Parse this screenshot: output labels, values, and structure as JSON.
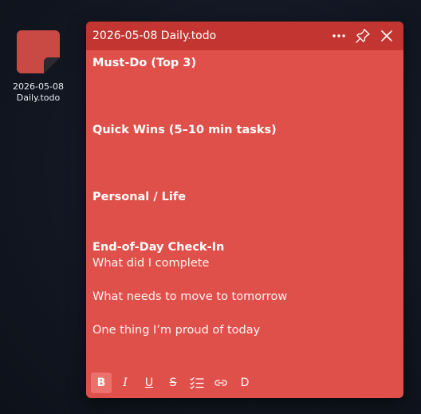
{
  "desktop": {
    "icon": {
      "name": "sticky-note-file-icon",
      "label": "2026-05-08\nDaily.todo",
      "color": "#d5504b"
    }
  },
  "window": {
    "title": "2026-05-08 Daily.todo",
    "titlebar_color": "#c23530",
    "body_color": "#e0504a",
    "actions": {
      "menu_icon": "more-horizontal-icon",
      "pin_icon": "pin-icon",
      "close_icon": "close-icon"
    }
  },
  "note": {
    "sections": [
      {
        "heading": "Must-Do (Top 3)"
      },
      {
        "heading": "Quick Wins (5–10 min tasks)"
      },
      {
        "heading": "Personal / Life"
      },
      {
        "heading": "End-of-Day Check-In"
      }
    ],
    "checkin_lines": [
      "What did I complete",
      "What needs to move to tomorrow",
      "One thing I’m proud of today"
    ]
  },
  "toolbar": {
    "bold": "B",
    "italic": "I",
    "underline": "U",
    "strikethrough": "S",
    "checklist_icon": "checklist-icon",
    "link_icon": "link-icon",
    "d_label": "D"
  }
}
